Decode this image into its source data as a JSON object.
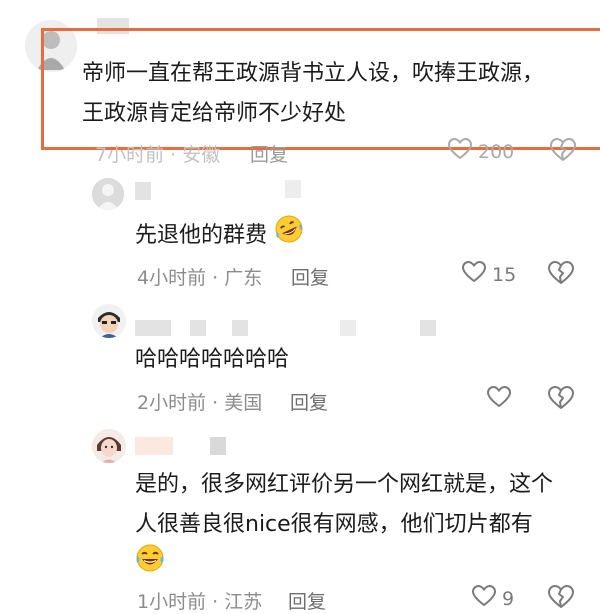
{
  "comments": [
    {
      "text_lines": [
        "帝师一直在帮王政源背书立人设，吹捧王政源，",
        "王政源肯定给帝师不少好处"
      ],
      "time": "7小时前",
      "location": "安徽",
      "reply_label": "回复",
      "likes": "200",
      "highlighted": true
    },
    {
      "text_lines": [
        "先退他的群费"
      ],
      "time": "4小时前",
      "location": "广东",
      "reply_label": "回复",
      "likes": "15",
      "emoji": "rolling-on-floor-laughing"
    },
    {
      "text_lines": [
        "哈哈哈哈哈哈哈"
      ],
      "time": "2小时前",
      "location": "美国",
      "reply_label": "回复",
      "likes": ""
    },
    {
      "text_lines": [
        "是的，很多网红评价另一个网红就是，这个",
        "人很善良很nice很有网感，他们切片都有"
      ],
      "time": "1小时前",
      "location": "江苏",
      "reply_label": "回复",
      "likes": "9",
      "emoji": "tears-of-joy"
    }
  ],
  "colors": {
    "highlight_border": "#ea6c3c",
    "meta_text": "#8c8c8c"
  },
  "icons": {
    "like": "heart-outline-icon",
    "dislike": "broken-heart-icon"
  }
}
